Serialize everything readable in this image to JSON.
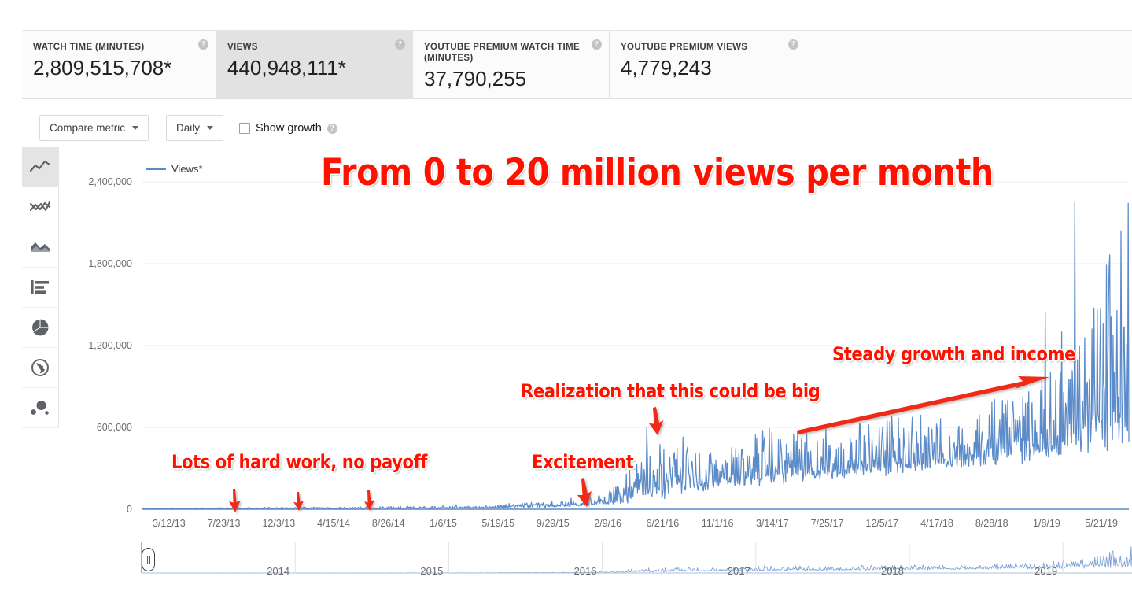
{
  "metrics": [
    {
      "label": "WATCH TIME (MINUTES)",
      "value": "2,809,515,708*",
      "selected": false,
      "help": "help-icon"
    },
    {
      "label": "VIEWS",
      "value": "440,948,111*",
      "selected": true,
      "help": "help-icon"
    },
    {
      "label": "YOUTUBE PREMIUM WATCH TIME (MINUTES)",
      "value": "37,790,255",
      "selected": false,
      "help": "help-icon"
    },
    {
      "label": "YOUTUBE PREMIUM VIEWS",
      "value": "4,779,243",
      "selected": false,
      "help": "help-icon"
    }
  ],
  "toolbar": {
    "compare_metric_label": "Compare metric",
    "interval_label": "Daily",
    "show_growth_label": "Show growth",
    "show_growth_checked": false
  },
  "sidebar": {
    "items": [
      {
        "name": "line-chart-icon",
        "active": true
      },
      {
        "name": "multi-line-chart-icon",
        "active": false
      },
      {
        "name": "area-chart-icon",
        "active": false
      },
      {
        "name": "bar-chart-icon",
        "active": false
      },
      {
        "name": "pie-chart-icon",
        "active": false
      },
      {
        "name": "globe-icon",
        "active": false
      },
      {
        "name": "bubble-chart-icon",
        "active": false
      }
    ]
  },
  "legend": {
    "series_label": "Views*",
    "color": "#5b8bc9"
  },
  "annotations": [
    {
      "id": "title",
      "text": "From 0 to 20 million views per month"
    },
    {
      "id": "hardwork",
      "text": "Lots of hard work, no payoff"
    },
    {
      "id": "excitement",
      "text": "Excitement"
    },
    {
      "id": "realization",
      "text": "Realization that this could be big"
    },
    {
      "id": "steady",
      "text": "Steady growth and income"
    }
  ],
  "annotation_color": "#ff1100",
  "range_selector": {
    "years": [
      "2014",
      "2015",
      "2016",
      "2017",
      "2018",
      "2019"
    ]
  },
  "chart_data": {
    "type": "line",
    "title": "From 0 to 20 million views per month",
    "xlabel": "",
    "ylabel": "",
    "ylim": [
      0,
      2400000
    ],
    "yticks": [
      0,
      600000,
      1200000,
      1800000,
      2400000
    ],
    "yticklabels": [
      "0",
      "600,000",
      "1,200,000",
      "1,800,000",
      "2,400,000"
    ],
    "grid": true,
    "legend_position": "top-left",
    "series": [
      {
        "name": "Views*",
        "color": "#5b8bc9",
        "note": "Daily YouTube views 3/12/13 - 5/21/19; near zero until mid-2016, then steady growth with heavy daily spikiness, peaking ~2,250,000 in 2019."
      }
    ],
    "xticklabels": [
      "3/12/13",
      "7/23/13",
      "12/3/13",
      "4/15/14",
      "8/26/14",
      "1/6/15",
      "5/19/15",
      "9/29/15",
      "2/9/16",
      "6/21/16",
      "11/1/16",
      "3/14/17",
      "7/25/17",
      "12/5/17",
      "4/17/18",
      "8/28/18",
      "1/8/19",
      "5/21/19"
    ],
    "envelope_points": [
      {
        "x": "3/12/13",
        "baseline": 2000,
        "peak": 9000
      },
      {
        "x": "7/23/13",
        "baseline": 2500,
        "peak": 11000
      },
      {
        "x": "12/3/13",
        "baseline": 3000,
        "peak": 14000
      },
      {
        "x": "4/15/14",
        "baseline": 3500,
        "peak": 16000
      },
      {
        "x": "8/26/14",
        "baseline": 4500,
        "peak": 20000
      },
      {
        "x": "1/6/15",
        "baseline": 6000,
        "peak": 25000
      },
      {
        "x": "5/19/15",
        "baseline": 9000,
        "peak": 35000
      },
      {
        "x": "9/29/15",
        "baseline": 16000,
        "peak": 55000
      },
      {
        "x": "2/9/16",
        "baseline": 40000,
        "peak": 110000
      },
      {
        "x": "6/21/16",
        "baseline": 120000,
        "peak": 600000
      },
      {
        "x": "11/1/16",
        "baseline": 180000,
        "peak": 420000
      },
      {
        "x": "3/14/17",
        "baseline": 230000,
        "peak": 620000
      },
      {
        "x": "7/25/17",
        "baseline": 260000,
        "peak": 560000
      },
      {
        "x": "12/5/17",
        "baseline": 300000,
        "peak": 700000
      },
      {
        "x": "4/17/18",
        "baseline": 330000,
        "peak": 660000
      },
      {
        "x": "8/28/18",
        "baseline": 380000,
        "peak": 900000
      },
      {
        "x": "1/8/19",
        "baseline": 450000,
        "peak": 1050000
      },
      {
        "x": "5/21/19",
        "baseline": 620000,
        "peak": 2250000
      }
    ]
  }
}
